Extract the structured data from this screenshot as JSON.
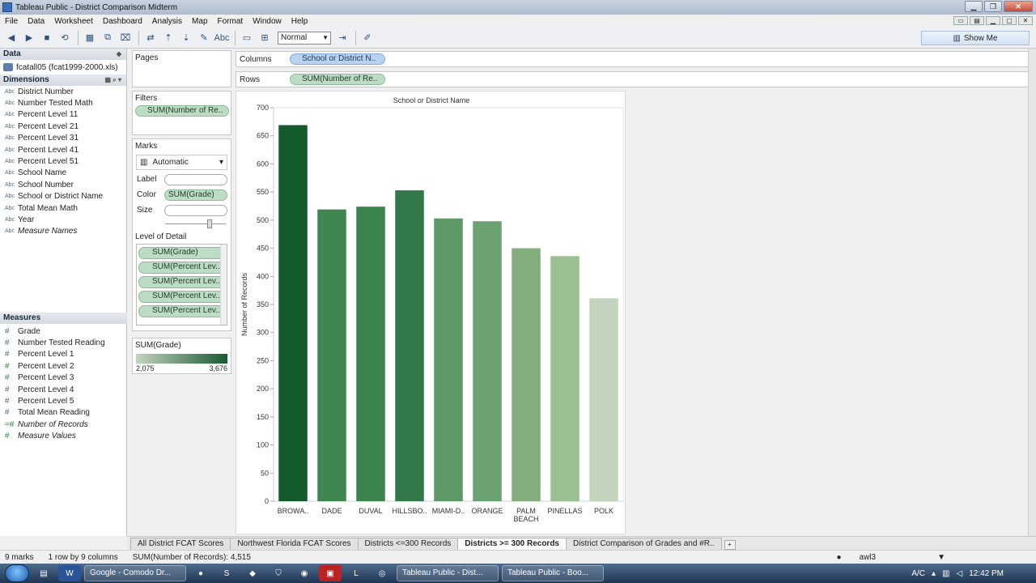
{
  "window": {
    "title": "Tableau Public - District Comparison Midterm"
  },
  "menu": [
    "File",
    "Data",
    "Worksheet",
    "Dashboard",
    "Analysis",
    "Map",
    "Format",
    "Window",
    "Help"
  ],
  "toolbar": {
    "mark_size_value": "Normal",
    "text_btn": "Abc",
    "show_me_label": "Show Me"
  },
  "data_pane": {
    "header": "Data",
    "datasource": "fcatall05 (fcat1999-2000.xls)",
    "dimensions_header": "Dimensions",
    "dimensions": [
      {
        "type": "Abc",
        "label": "District Number"
      },
      {
        "type": "Abc",
        "label": "Number Tested Math"
      },
      {
        "type": "Abc",
        "label": "Percent Level 11"
      },
      {
        "type": "Abc",
        "label": "Percent Level 21"
      },
      {
        "type": "Abc",
        "label": "Percent Level 31"
      },
      {
        "type": "Abc",
        "label": "Percent Level 41"
      },
      {
        "type": "Abc",
        "label": "Percent Level 51"
      },
      {
        "type": "Abc",
        "label": "School Name"
      },
      {
        "type": "Abc",
        "label": "School Number"
      },
      {
        "type": "Abc",
        "label": "School or District Name"
      },
      {
        "type": "Abc",
        "label": "Total Mean Math"
      },
      {
        "type": "Abc",
        "label": "Year"
      },
      {
        "type": "Abc",
        "label": "Measure Names"
      }
    ],
    "measures_header": "Measures",
    "measures": [
      {
        "type": "#",
        "label": "Grade"
      },
      {
        "type": "#",
        "label": "Number Tested Reading"
      },
      {
        "type": "#",
        "label": "Percent Level 1"
      },
      {
        "type": "#",
        "label": "Percent Level 2"
      },
      {
        "type": "#",
        "label": "Percent Level 3"
      },
      {
        "type": "#",
        "label": "Percent Level 4"
      },
      {
        "type": "#",
        "label": "Percent Level 5"
      },
      {
        "type": "#",
        "label": "Total Mean Reading"
      },
      {
        "type": "=#",
        "label": "Number of Records"
      },
      {
        "type": "#",
        "label": "Measure Values"
      }
    ]
  },
  "pages": {
    "title": "Pages"
  },
  "filters": {
    "title": "Filters",
    "pill": "SUM(Number of Re.."
  },
  "marks": {
    "title": "Marks",
    "type": "Automatic",
    "label_label": "Label",
    "color_label": "Color",
    "color_pill": "SUM(Grade)",
    "size_label": "Size",
    "lod_title": "Level of Detail",
    "lod_pills": [
      "SUM(Grade)",
      "SUM(Percent Lev..",
      "SUM(Percent Lev..",
      "SUM(Percent Lev..",
      "SUM(Percent Lev.."
    ]
  },
  "legend": {
    "title": "SUM(Grade)",
    "min": "2,075",
    "max": "3,676",
    "color_low": "#c4d4be",
    "color_high": "#165a30"
  },
  "columns_shelf": {
    "label": "Columns",
    "pill": "School or District N.."
  },
  "rows_shelf": {
    "label": "Rows",
    "pill": "SUM(Number of Re.."
  },
  "chart_data": {
    "type": "bar",
    "title": "School or District Name",
    "ylabel": "Number of Records",
    "xlabel": "",
    "categories": [
      "BROWA..",
      "DADE",
      "DUVAL",
      "HILLSBO..",
      "MIAMI-D..",
      "ORANGE",
      "PALM BEACH",
      "PINELLAS",
      "POLK"
    ],
    "values": [
      669,
      519,
      524,
      553,
      503,
      498,
      450,
      436,
      361
    ],
    "colors": [
      "#135a2c",
      "#3f8650",
      "#3c844e",
      "#33784a",
      "#5e9868",
      "#6aa271",
      "#84ad7d",
      "#9bbf93",
      "#c2d4bd"
    ],
    "ylim": [
      0,
      700
    ],
    "yticks": [
      0,
      50,
      100,
      150,
      200,
      250,
      300,
      350,
      400,
      450,
      500,
      550,
      600,
      650,
      700
    ],
    "grid": false
  },
  "tabs": [
    {
      "label": "All District FCAT Scores",
      "active": false
    },
    {
      "label": "Northwest Florida FCAT Scores",
      "active": false
    },
    {
      "label": "Districts <=300 Records",
      "active": false
    },
    {
      "label": "Districts >= 300 Records",
      "active": true
    },
    {
      "label": "District Comparison of Grades and #R..",
      "active": false
    }
  ],
  "status": {
    "marks": "9 marks",
    "dims": "1 row by 9 columns",
    "sum": "SUM(Number of Records): 4,515",
    "user": "awl3"
  },
  "taskbar": {
    "tasks": [
      "Google - Comodo Dr...",
      "Tableau Public - Dist...",
      "Tableau Public - Boo..."
    ],
    "tray_text": "A/C",
    "clock": "12:42 PM"
  }
}
